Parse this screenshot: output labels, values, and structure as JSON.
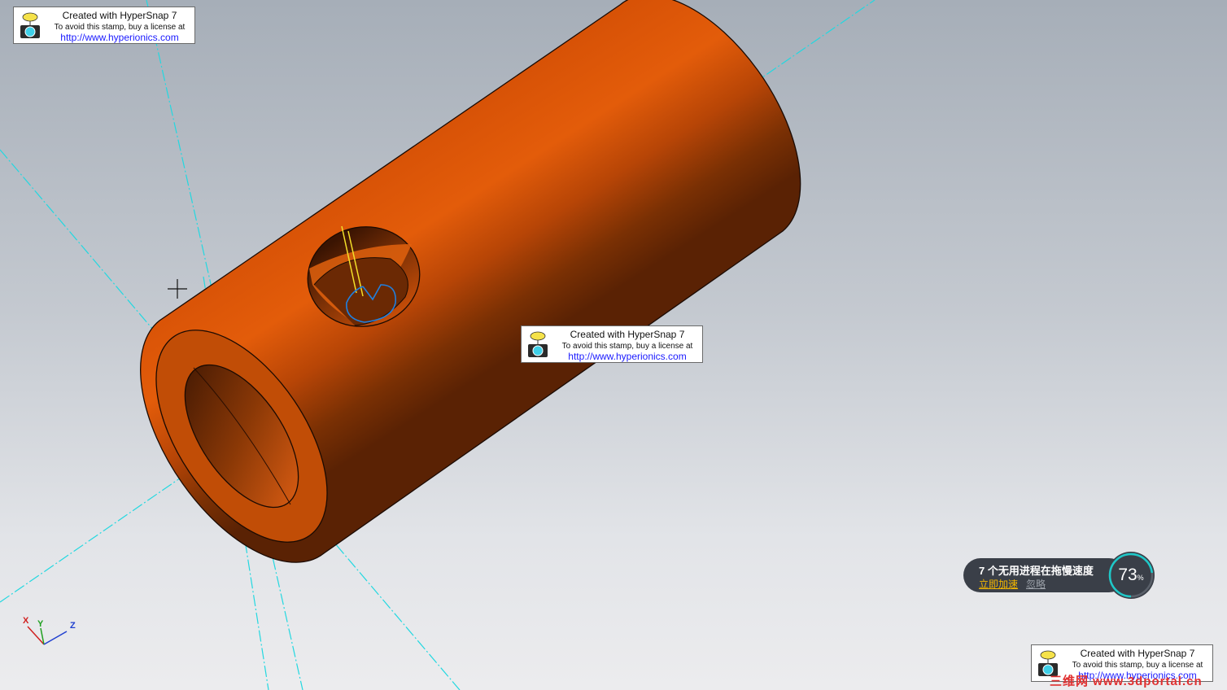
{
  "stamps": [
    {
      "line1": "Created with HyperSnap 7",
      "line2": "To avoid this stamp, buy a license at",
      "line3": "http://www.hyperionics.com"
    },
    {
      "line1": "Created with HyperSnap 7",
      "line2": "To avoid this stamp, buy a license at",
      "line3": "http://www.hyperionics.com"
    },
    {
      "line1": "Created with HyperSnap 7",
      "line2": "To avoid this stamp, buy a license at",
      "line3": "http://www.hyperionics.com"
    }
  ],
  "notification": {
    "message": "7 个无用进程在拖慢速度",
    "action": "立即加速",
    "ignore": "忽略",
    "percent": "73",
    "percent_unit": "%",
    "progress": 0.73
  },
  "triad": {
    "x": "X",
    "y": "Y",
    "z": "Z"
  },
  "watermark": "三维网 www.3dportal.cn",
  "colors": {
    "part_orange": "#e05a0c",
    "part_dark": "#6a2a06",
    "axis_cyan": "#22d8e0",
    "gauge_ring": "#1ec8c8"
  }
}
